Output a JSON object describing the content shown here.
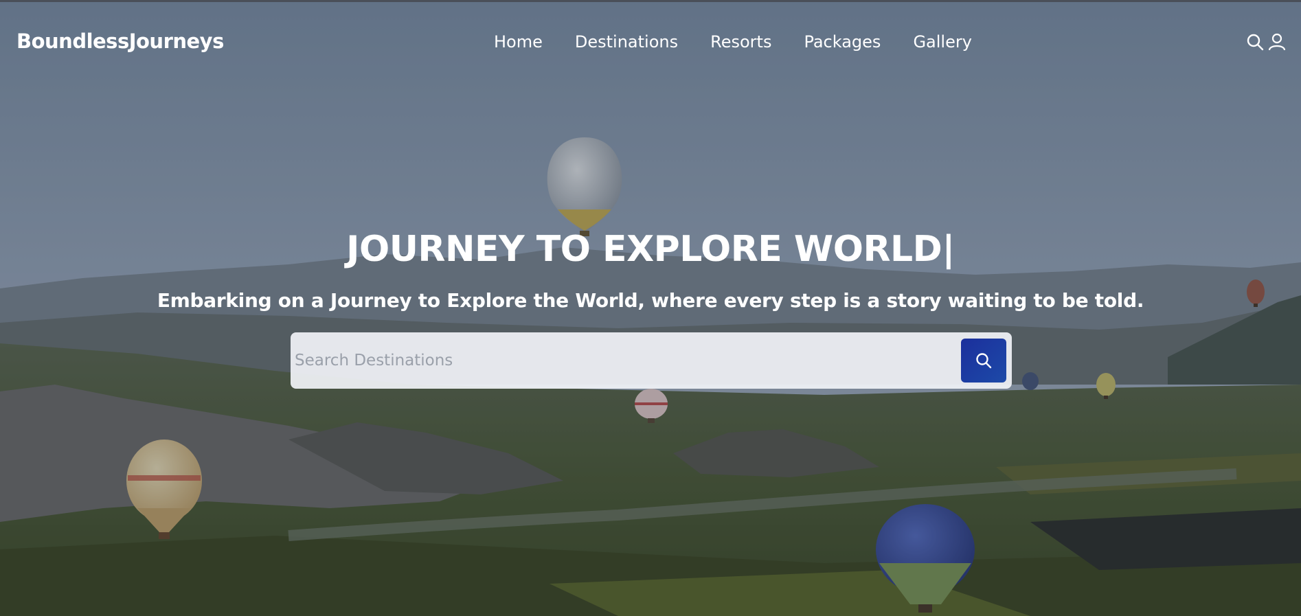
{
  "brand": {
    "name": "BoundlessJourneys"
  },
  "nav": {
    "items": [
      {
        "label": "Home"
      },
      {
        "label": "Destinations"
      },
      {
        "label": "Resorts"
      },
      {
        "label": "Packages"
      },
      {
        "label": "Gallery"
      }
    ],
    "icons": [
      "search-icon",
      "user-icon"
    ]
  },
  "hero": {
    "headline": "JOURNEY TO EXPLORE WORLD|",
    "tagline": "Embarking on a Journey to Explore the World, where every step is a story waiting to be told.",
    "background": "hot air balloons over valley landscape"
  },
  "search": {
    "placeholder": "Search Destinations",
    "value": "",
    "button_icon": "search-icon"
  },
  "colors": {
    "search_button": "#1b2f9c",
    "text": "#ffffff"
  }
}
